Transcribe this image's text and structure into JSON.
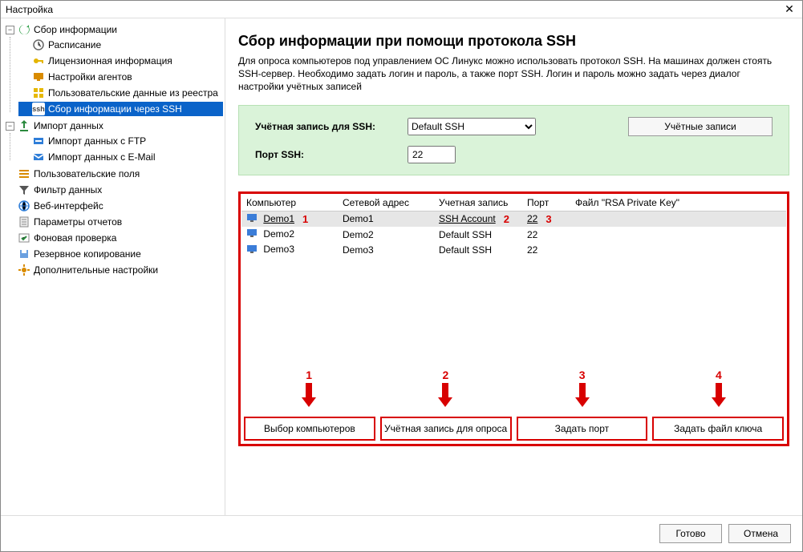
{
  "window": {
    "title": "Настройка"
  },
  "tree": {
    "n0": {
      "label": "Сбор информации"
    },
    "n0c": {
      "schedule": {
        "label": "Расписание"
      },
      "license": {
        "label": "Лицензионная информация"
      },
      "agents": {
        "label": "Настройки агентов"
      },
      "registry": {
        "label": "Пользовательские данные из реестра"
      },
      "ssh": {
        "label": "Сбор информации через SSH",
        "prefix": "ssh"
      }
    },
    "n1": {
      "label": "Импорт данных"
    },
    "n1c": {
      "ftp": {
        "label": "Импорт данных с FTP"
      },
      "email": {
        "label": "Импорт данных с E-Mail"
      }
    },
    "userfields": {
      "label": "Пользовательские поля"
    },
    "filter": {
      "label": "Фильтр данных"
    },
    "web": {
      "label": "Веб-интерфейс"
    },
    "reports": {
      "label": "Параметры отчетов"
    },
    "bgcheck": {
      "label": "Фоновая проверка"
    },
    "backup": {
      "label": "Резервное копирование"
    },
    "extra": {
      "label": "Дополнительные настройки"
    }
  },
  "main": {
    "heading": "Сбор информации при помощи протокола SSH",
    "desc": "Для опроса компьютеров под управлением ОС Линукс можно использовать протокол SSH. На машинах должен стоять SSH-сервер. Необходимо задать логин и пароль, а также порт SSH.  Логин и пароль можно задать через диалог настройки учётных записей",
    "account_label": "Учётная запись для SSH:",
    "account_value": "Default SSH",
    "port_label": "Порт SSH:",
    "port_value": "22",
    "accounts_btn": "Учётные записи"
  },
  "list": {
    "columns": {
      "computer": "Компьютер",
      "address": "Сетевой адрес",
      "account": "Учетная запись",
      "port": "Порт",
      "key": "Файл \"RSA Private Key\""
    },
    "rows": [
      {
        "computer": "Demo1",
        "address": "Demo1",
        "account": "SSH Account",
        "port": "22"
      },
      {
        "computer": "Demo2",
        "address": "Demo2",
        "account": "Default SSH",
        "port": "22"
      },
      {
        "computer": "Demo3",
        "address": "Demo3",
        "account": "Default SSH",
        "port": "22"
      }
    ],
    "ann": {
      "a1": "1",
      "a2": "2",
      "a3": "3",
      "b1": "1",
      "b2": "2",
      "b3": "3",
      "b4": "4"
    }
  },
  "buttons": {
    "select_computers": "Выбор компьютеров",
    "poll_account": "Учётная запись для опроса",
    "set_port": "Задать порт",
    "set_keyfile": "Задать файл ключа"
  },
  "footer": {
    "ok": "Готово",
    "cancel": "Отмена"
  }
}
